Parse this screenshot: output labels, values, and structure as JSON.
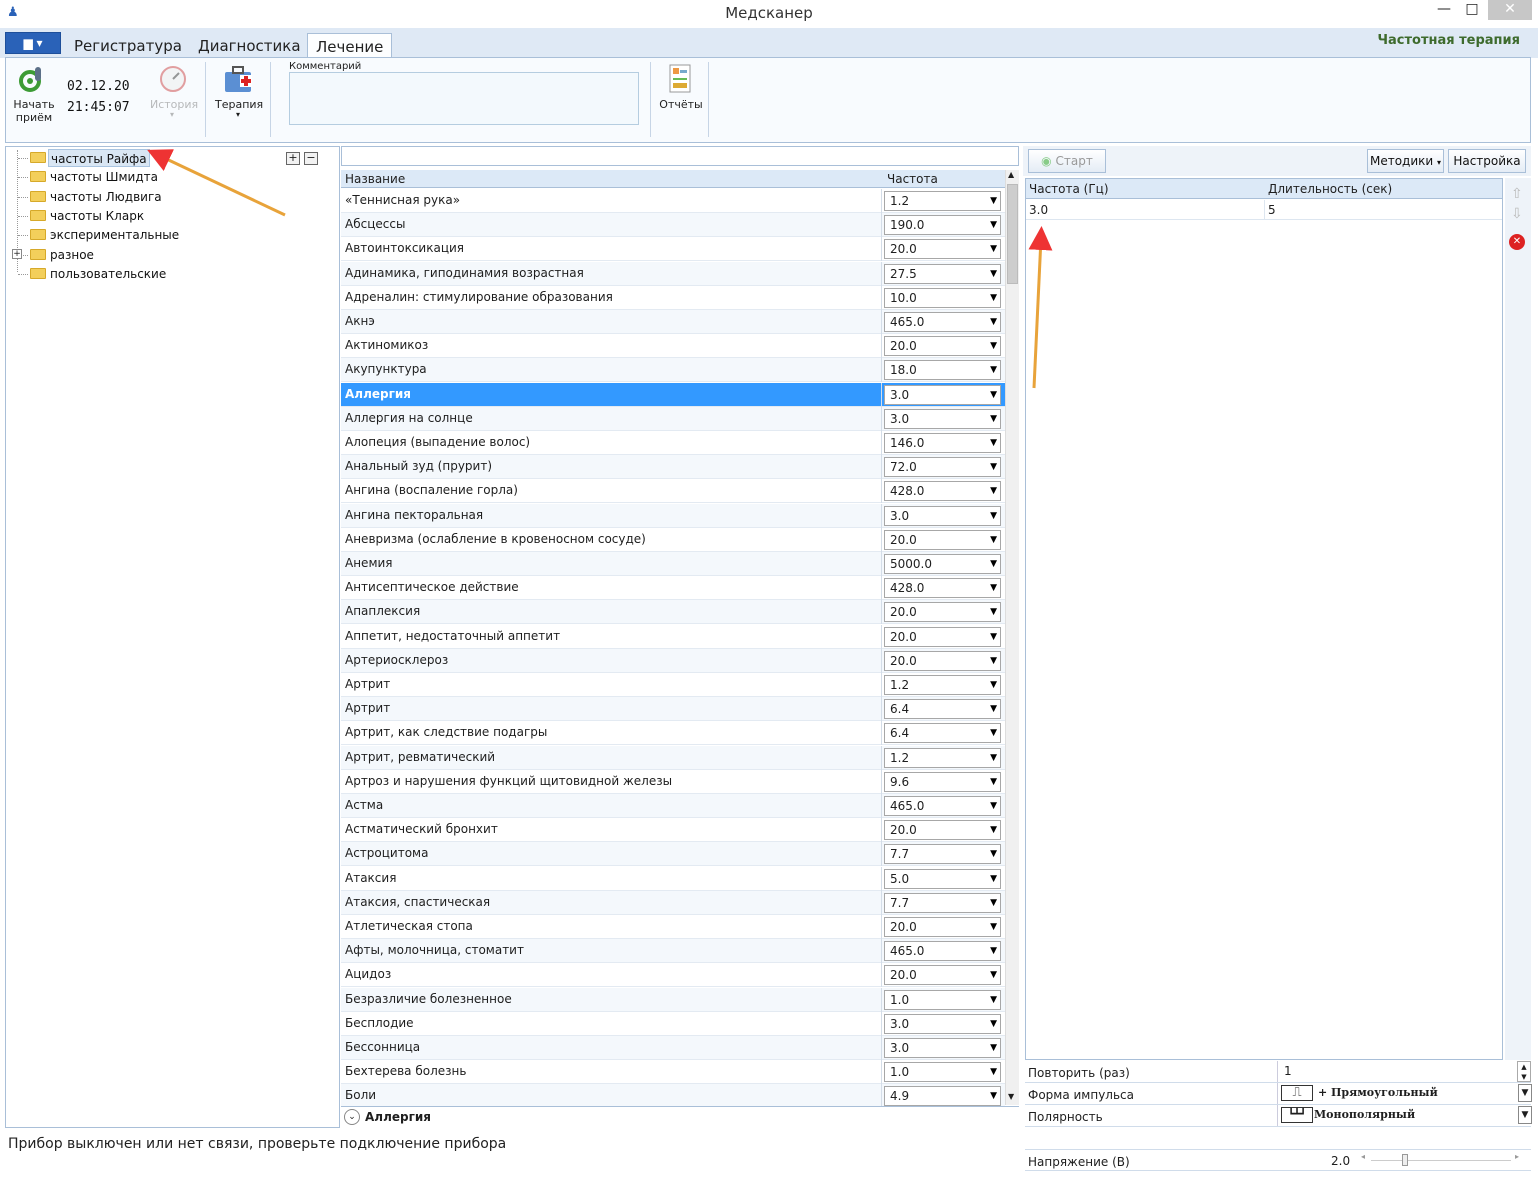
{
  "window": {
    "title": "Медсканер",
    "minimize": "—",
    "maximize": "□",
    "close": "✕"
  },
  "tabs": [
    {
      "label": "Регистратура"
    },
    {
      "label": "Диагностика"
    },
    {
      "label": "Лечение"
    }
  ],
  "section_title": "Частотная терапия",
  "ribbon": {
    "start_label": "Начать приём",
    "date": "02.12.20",
    "time": "21:45:07",
    "history_label": "История",
    "therapy_label": "Терапия",
    "comment_label": "Комментарий",
    "reports_label": "Отчёты"
  },
  "tree": {
    "items": [
      {
        "label": "частоты Райфа",
        "selected": true
      },
      {
        "label": "частоты Шмидта"
      },
      {
        "label": "частоты Людвига"
      },
      {
        "label": "частоты Кларк"
      },
      {
        "label": "экспериментальные"
      },
      {
        "label": "разное",
        "expandable": true
      },
      {
        "label": "пользовательские"
      }
    ],
    "expand_all": "+",
    "collapse_all": "−"
  },
  "grid": {
    "headers": {
      "name": "Название",
      "freq": "Частота"
    },
    "rows": [
      {
        "name": "«Теннисная рука»",
        "freq": "1.2"
      },
      {
        "name": "Абсцессы",
        "freq": "190.0"
      },
      {
        "name": "Автоинтоксикация",
        "freq": "20.0"
      },
      {
        "name": "Адинамика, гиподинамия возрастная",
        "freq": "27.5"
      },
      {
        "name": "Адреналин: стимулирование образования",
        "freq": "10.0"
      },
      {
        "name": "Акнэ",
        "freq": "465.0"
      },
      {
        "name": "Актиномикоз",
        "freq": "20.0"
      },
      {
        "name": "Акупунктура",
        "freq": "18.0"
      },
      {
        "name": "Аллергия",
        "freq": "3.0",
        "selected": true
      },
      {
        "name": "Аллергия на солнце",
        "freq": "3.0"
      },
      {
        "name": "Алопеция (выпадение волос)",
        "freq": "146.0"
      },
      {
        "name": "Анальный зуд (прурит)",
        "freq": "72.0"
      },
      {
        "name": "Ангина (воспаление горла)",
        "freq": "428.0"
      },
      {
        "name": "Ангина пекторальная",
        "freq": "3.0"
      },
      {
        "name": "Аневризма (ослабление в кровеносном сосуде)",
        "freq": "20.0"
      },
      {
        "name": "Анемия",
        "freq": "5000.0"
      },
      {
        "name": "Антисептическое действие",
        "freq": "428.0"
      },
      {
        "name": "Апаплексия",
        "freq": "20.0"
      },
      {
        "name": "Аппетит, недостаточный аппетит",
        "freq": "20.0"
      },
      {
        "name": "Артериосклероз",
        "freq": "20.0"
      },
      {
        "name": "Артрит",
        "freq": "1.2"
      },
      {
        "name": "Артрит",
        "freq": "6.4"
      },
      {
        "name": "Артрит, как следствие подагры",
        "freq": "6.4"
      },
      {
        "name": "Артрит, ревматический",
        "freq": "1.2"
      },
      {
        "name": "Артроз и нарушения функций щитовидной  железы",
        "freq": "9.6"
      },
      {
        "name": "Астма",
        "freq": "465.0"
      },
      {
        "name": "Астматический бронхит",
        "freq": "20.0"
      },
      {
        "name": "Астроцитома",
        "freq": "7.7"
      },
      {
        "name": "Атаксия",
        "freq": "5.0"
      },
      {
        "name": "Атаксия, спастическая",
        "freq": "7.7"
      },
      {
        "name": "Атлетическая стопа",
        "freq": "20.0"
      },
      {
        "name": "Афты, молочница, стоматит",
        "freq": "465.0"
      },
      {
        "name": "Ацидоз",
        "freq": "20.0"
      },
      {
        "name": "Безразличие болезненное",
        "freq": "1.0"
      },
      {
        "name": "Бесплодие",
        "freq": "3.0"
      },
      {
        "name": "Бессонница",
        "freq": "3.0"
      },
      {
        "name": "Бехтерева болезнь",
        "freq": "1.0"
      },
      {
        "name": "Боли",
        "freq": "4.9"
      }
    ],
    "footer": "Аллергия"
  },
  "status_message": "Прибор выключен или нет связи, проверьте подключение прибора",
  "right": {
    "start_label": "Старт",
    "methods_label": "Методики",
    "settings_label": "Настройка",
    "headers": {
      "freq": "Частота (Гц)",
      "duration": "Длительность (сек)"
    },
    "rows": [
      {
        "freq": "3.0",
        "duration": "5"
      }
    ],
    "props": [
      {
        "label": "Повторить (раз)",
        "value": "1"
      },
      {
        "label": "Форма импульса",
        "value": "+ Прямоугольный"
      },
      {
        "label": "Полярность",
        "value": "Монополярный"
      }
    ],
    "voltage": {
      "label": "Напряжение (В)",
      "value": "2.0"
    }
  },
  "colors": {
    "accent": "#2a62b8",
    "selection": "#3399ff",
    "header": "#dce9f7",
    "ribbon_title": "#3e6b2d",
    "annotation_arrow": "#e8a33a"
  }
}
